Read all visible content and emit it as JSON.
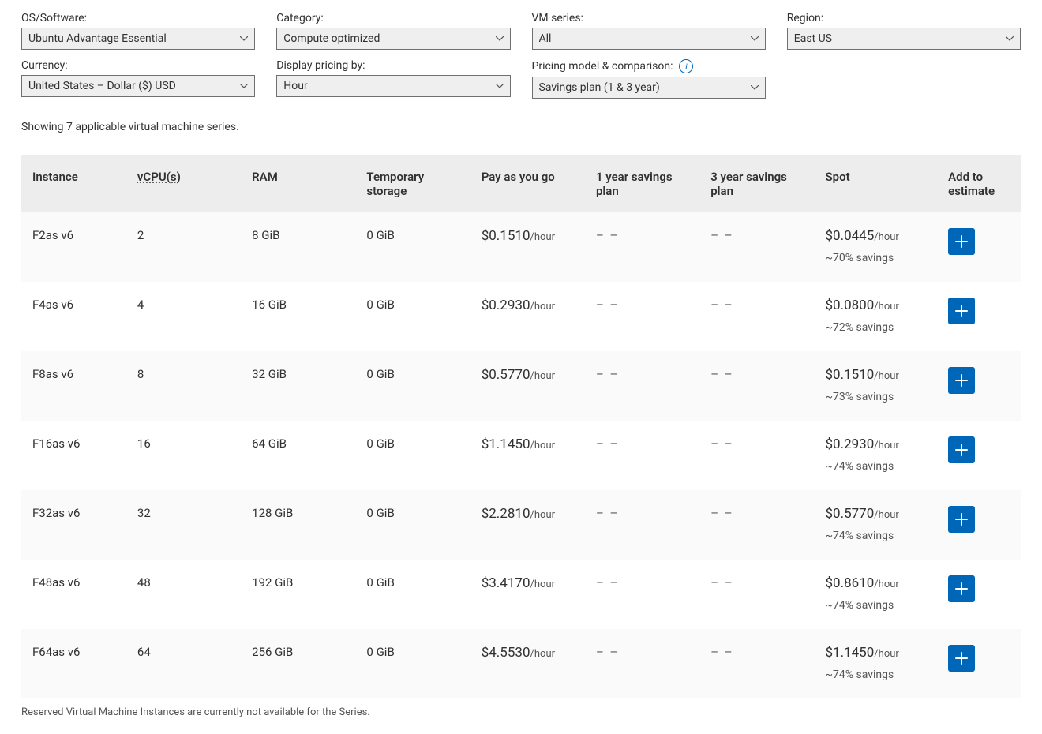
{
  "filters": {
    "os_label": "OS/Software:",
    "os_value": "Ubuntu Advantage Essential",
    "category_label": "Category:",
    "category_value": "Compute optimized",
    "vmseries_label": "VM series:",
    "vmseries_value": "All",
    "region_label": "Region:",
    "region_value": "East US",
    "currency_label": "Currency:",
    "currency_value": "United States – Dollar ($) USD",
    "displayby_label": "Display pricing by:",
    "displayby_value": "Hour",
    "pricingmodel_label": "Pricing model & comparison:",
    "pricingmodel_value": "Savings plan (1 & 3 year)"
  },
  "results_msg": "Showing 7 applicable virtual machine series.",
  "columns": {
    "instance": "Instance",
    "vcpu": "vCPU(s)",
    "ram": "RAM",
    "temp": "Temporary storage",
    "payg": "Pay as you go",
    "sp1": "1 year savings plan",
    "sp3": "3 year savings plan",
    "spot": "Spot",
    "add": "Add to estimate"
  },
  "unit": "/hour",
  "dash": "– –",
  "rows": [
    {
      "instance": "F2as v6",
      "vcpu": "2",
      "ram": "8 GiB",
      "temp": "0 GiB",
      "payg": "$0.1510",
      "sp1": "",
      "sp3": "",
      "spot": "$0.0445",
      "savings": "~70% savings"
    },
    {
      "instance": "F4as v6",
      "vcpu": "4",
      "ram": "16 GiB",
      "temp": "0 GiB",
      "payg": "$0.2930",
      "sp1": "",
      "sp3": "",
      "spot": "$0.0800",
      "savings": "~72% savings"
    },
    {
      "instance": "F8as v6",
      "vcpu": "8",
      "ram": "32 GiB",
      "temp": "0 GiB",
      "payg": "$0.5770",
      "sp1": "",
      "sp3": "",
      "spot": "$0.1510",
      "savings": "~73% savings"
    },
    {
      "instance": "F16as v6",
      "vcpu": "16",
      "ram": "64 GiB",
      "temp": "0 GiB",
      "payg": "$1.1450",
      "sp1": "",
      "sp3": "",
      "spot": "$0.2930",
      "savings": "~74% savings"
    },
    {
      "instance": "F32as v6",
      "vcpu": "32",
      "ram": "128 GiB",
      "temp": "0 GiB",
      "payg": "$2.2810",
      "sp1": "",
      "sp3": "",
      "spot": "$0.5770",
      "savings": "~74% savings"
    },
    {
      "instance": "F48as v6",
      "vcpu": "48",
      "ram": "192 GiB",
      "temp": "0 GiB",
      "payg": "$3.4170",
      "sp1": "",
      "sp3": "",
      "spot": "$0.8610",
      "savings": "~74% savings"
    },
    {
      "instance": "F64as v6",
      "vcpu": "64",
      "ram": "256 GiB",
      "temp": "0 GiB",
      "payg": "$4.5530",
      "sp1": "",
      "sp3": "",
      "spot": "$1.1450",
      "savings": "~74% savings"
    }
  ],
  "footnote": "Reserved Virtual Machine Instances are currently not available for the Series."
}
